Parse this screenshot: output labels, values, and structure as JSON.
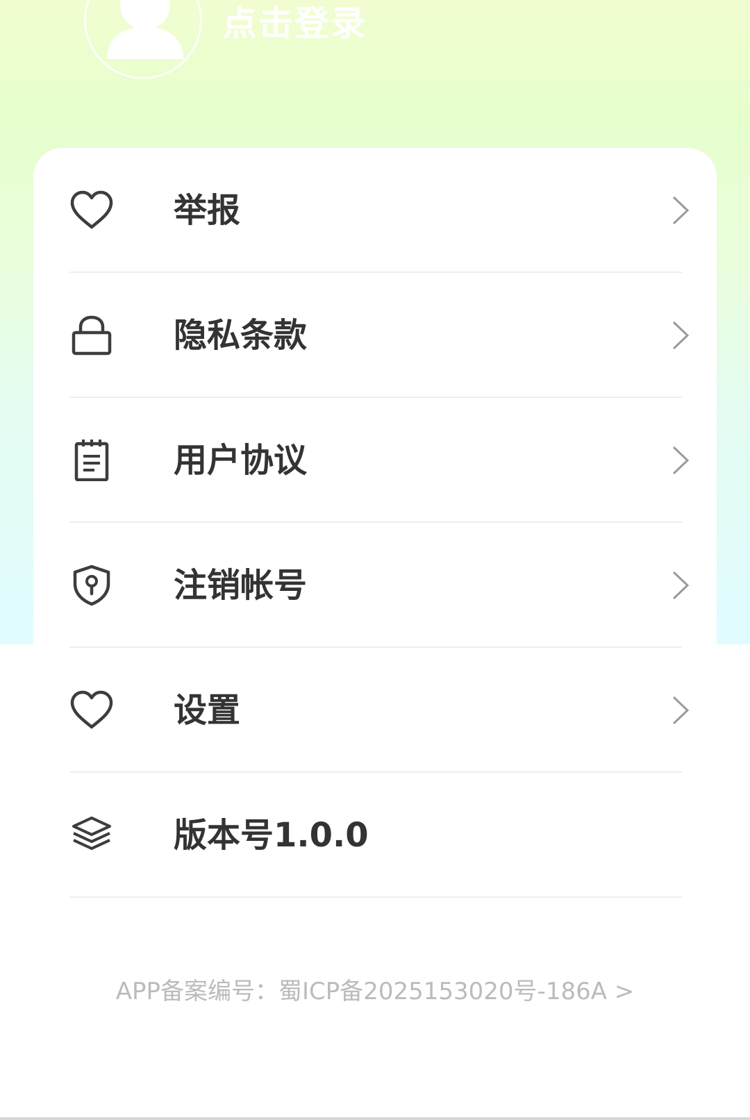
{
  "profile": {
    "login_label": "点击登录"
  },
  "menu": {
    "items": [
      {
        "label": "举报",
        "icon": "heart-icon",
        "has_arrow": true
      },
      {
        "label": "隐私条款",
        "icon": "lock-icon",
        "has_arrow": true
      },
      {
        "label": "用户协议",
        "icon": "notepad-icon",
        "has_arrow": true
      },
      {
        "label": "注销帐号",
        "icon": "shield-keyhole-icon",
        "has_arrow": true
      },
      {
        "label": "设置",
        "icon": "heart-icon",
        "has_arrow": true
      },
      {
        "label": "版本号1.0.0",
        "icon": "layers-icon",
        "has_arrow": false
      }
    ]
  },
  "footer": {
    "record_text": "APP备案编号：蜀ICP备2025153020号-186A >"
  },
  "colors": {
    "gradient_top": "#f1fdd0",
    "gradient_bottom": "#e0fcff",
    "label_text": "#333333",
    "divider": "#eeeeee",
    "footer_text": "#bbbbbb"
  }
}
